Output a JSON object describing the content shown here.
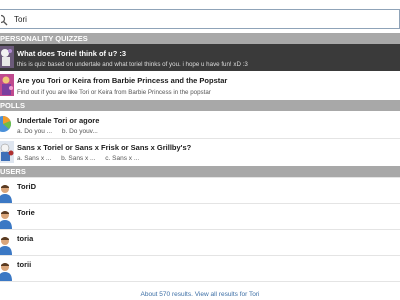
{
  "search": {
    "value": "Tori"
  },
  "sections": {
    "personality_quizzes": "PERSONALITY QUIZZES",
    "polls": "POLLS",
    "users": "USERS"
  },
  "quizzes": [
    {
      "title": "What does Toriel think of u? :3",
      "desc": "this is quiz based on undertale and what toriel thinks of you. i hope u have fun! xD :3"
    },
    {
      "title": "Are you Tori or Keira from Barbie Princess and the Popstar",
      "desc": "Find out if you are like Tori or Keira from Barbie Princess in the popstar"
    }
  ],
  "polls": [
    {
      "title": "Undertale Tori or agore",
      "options": [
        "a. Do you ...",
        "b. Do youv..."
      ]
    },
    {
      "title": "Sans x Toriel or Sans x Frisk or Sans x Grillby's?",
      "options": [
        "a. Sans x ...",
        "b. Sans x ...",
        "c. Sans x ..."
      ]
    }
  ],
  "users": [
    "ToriD",
    "Torie",
    "toria",
    "torii"
  ],
  "footer": {
    "text": "About 570 results. View all results for Tori"
  },
  "colors": {
    "section_bg": "#a8a8a8",
    "selected_bg": "#3a3a3a",
    "link": "#3b6ea5"
  }
}
